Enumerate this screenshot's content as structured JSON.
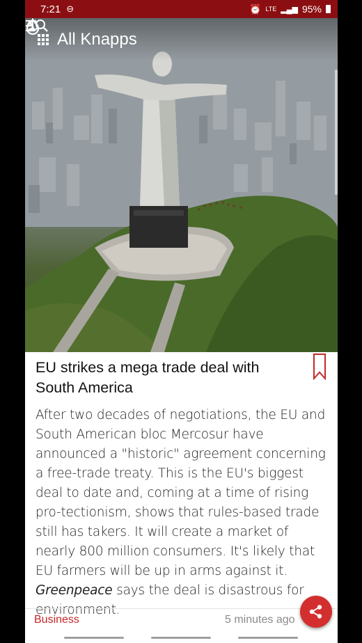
{
  "status_bar": {
    "time": "7:21",
    "left_icons": [
      "minus-circle-icon",
      "do-not-disturb-icon"
    ],
    "network": "LTE",
    "battery": "95%",
    "background": "#8b0f12"
  },
  "app_bar": {
    "title": "All Knapps",
    "actions": [
      "fire-icon",
      "refresh-icon",
      "search-list-icon"
    ]
  },
  "article": {
    "headline": "EU strikes a mega trade deal with South America",
    "body_parts": {
      "main": "After two decades of negotiations, the EU and South American bloc Mercosur have announced a \"historic\" agreement concerning a free-trade treaty. This is the EU's biggest deal to date and, coming at a time of rising pro-tectionism, shows that rules-based trade still has takers. It will create a market of nearly 800 million consumers. It's likely that EU farmers will be up in arms against it. ",
      "emphasis": "Greenpeace",
      "tail": " says the deal is disastrous for environment."
    },
    "category": "Business",
    "timestamp": "5 minutes ago",
    "accent_color": "#c62828"
  }
}
